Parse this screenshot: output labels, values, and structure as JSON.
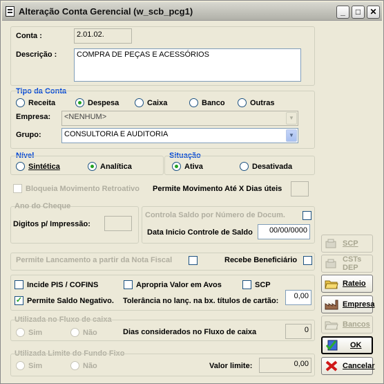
{
  "window": {
    "title": "Alteração Conta Gerencial (w_scb_pcg1)",
    "minimize": "_",
    "maximize": "□",
    "close": "✕"
  },
  "conta": {
    "label": "Conta :",
    "value": "2.01.02."
  },
  "descricao": {
    "label": "Descrição :",
    "value": "COMPRA DE PEÇAS E ACESSÓRIOS"
  },
  "tipo_conta": {
    "title": "Tipo da Conta",
    "options": [
      {
        "label": "Receita",
        "selected": false
      },
      {
        "label": "Despesa",
        "selected": true
      },
      {
        "label": "Caixa",
        "selected": false
      },
      {
        "label": "Banco",
        "selected": false
      },
      {
        "label": "Outras",
        "selected": false
      }
    ],
    "empresa_label": "Empresa:",
    "empresa_value": "<NENHUM>",
    "grupo_label": "Grupo:",
    "grupo_value": "CONSULTORIA E AUDITORIA"
  },
  "nivel": {
    "title": "Nível",
    "options": [
      {
        "label": "Sintética",
        "selected": false
      },
      {
        "label": "Analítica",
        "selected": true
      }
    ]
  },
  "situacao": {
    "title": "Situação",
    "options": [
      {
        "label": "Ativa",
        "selected": true
      },
      {
        "label": "Desativada",
        "selected": false
      }
    ]
  },
  "bloqueia_movimento": {
    "label": "Bloqueia Movimento Retroativo",
    "checked": false,
    "enabled": false
  },
  "permite_movimento_dias": {
    "label": "Permite Movimento Até X Dias úteis",
    "value": ""
  },
  "ano_cheque": {
    "title": "Ano do Cheque",
    "digitos_label": "Digitos p/ Impressão:",
    "digitos_value": ""
  },
  "controla_saldo": {
    "label": "Controla  Saldo por Número de Docum.",
    "checked": false,
    "data_label": "Data Inicio Controle de Saldo",
    "data_value": "00/00/0000"
  },
  "permite_lancamento_nf": {
    "label": "Permite Lancamento a partir da Nota Fiscal",
    "checked": false
  },
  "recebe_beneficiario": {
    "label": "Recebe Beneficiário",
    "checked": false
  },
  "incide_pis": {
    "label": "Incide PIS / COFINS",
    "checked": false
  },
  "apropria_valor": {
    "label": "Apropria Valor em Avos",
    "checked": false
  },
  "scp_check": {
    "label": "SCP",
    "checked": false
  },
  "permite_saldo_negativo": {
    "label": "Permite Saldo Negativo.",
    "checked": true
  },
  "tolerancia": {
    "label": "Tolerância no lanç. na bx. títulos de cartão:",
    "value": "0,00"
  },
  "fluxo_caixa": {
    "title": "Utilizada no Fluxo de caixa",
    "sim": "Sim",
    "nao": "Não",
    "dias_label": "Dias considerados no Fluxo de caixa",
    "dias_value": "0"
  },
  "limite_fundo": {
    "title": "Utilizada Limite do Fundo Fixo",
    "sim": "Sim",
    "nao": "Não",
    "valor_label": "Valor limite:",
    "valor_value": "0,00"
  },
  "buttons": {
    "scp": "SCP",
    "csts": "CSTs DEP",
    "rateio": "Rateio",
    "empresa": "Empresa",
    "bancos": "Bancos",
    "ok": "OK",
    "cancelar": "Cancelar"
  }
}
